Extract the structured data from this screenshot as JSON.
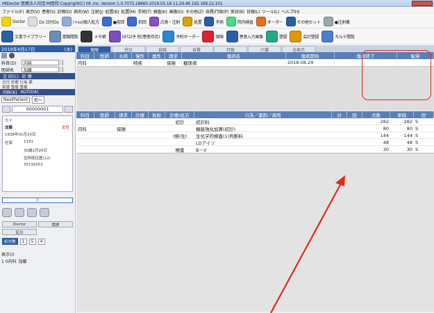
{
  "titlebar": {
    "text": "MIDoctor 医療法人社団 MI医院 Copyright(C) MI ,Inc. Version 1.0.7075.18660 2019.05.18 11:29.46 192.168.22.101"
  },
  "menu": [
    "ファイル(F)",
    "表示(V)",
    "患者(S)",
    "診療(D)",
    "病名(W)",
    "注射(J)",
    "処置(K)",
    "処置(M)",
    "手術(T)",
    "検査(K)",
    "画像(G)",
    "その他(Z)",
    "自費/行政(P)",
    "実日(B)",
    "日報(L)",
    "ツール(L)",
    "ヘルプ(H)"
  ],
  "toolbar1": [
    "Doctor",
    "Do 日付Do",
    "(+xx)個人処方",
    "●前回",
    "前回",
    "点滴・注射",
    "処置",
    "手術",
    "院内検査",
    "オーダー",
    "その他セット",
    "●注射薬"
  ],
  "toolbar2": [
    "文書ライブラリー",
    "書類閲覧",
    "メモ帳",
    "(972)予 約(患者待合)",
    "予約オーダー",
    "保険",
    "患者入力画像",
    "登録",
    "会計登録",
    "カルテ閲覧"
  ],
  "left": {
    "date": "2019年4月17日",
    "weekday": "(水)",
    "dept_label": "科目(D)",
    "dept_value": "内科",
    "doctor_label": "医師名",
    "doctor_value": "加藤",
    "shift_label": "注 記(C)",
    "record_label": "診 療",
    "options": [
      "日付",
      "診療",
      "行為",
      "薬",
      "部選",
      "重複",
      "重複",
      "重複"
    ],
    "dept2": "内科(K)",
    "autoA": "AUTO(A)",
    "next_patient": "NextPatient",
    "prev": "前へ",
    "patient_id": "00000001",
    "patient_age_label": "カナ",
    "patient_name": "加藤",
    "gender": "女性",
    "birth": "1938年01月20日",
    "insurance": "社保",
    "id2": "1191",
    "label_last": "30歳1月20日",
    "label_stat": "住所既往歴(12)",
    "label_num": "35192001",
    "btn_doc": "Doctor",
    "btn_k": "請求",
    "btn_k2": "区分",
    "rx": "処方数",
    "rx_n": [
      "1",
      "5",
      "4"
    ],
    "disp_label": "表示(I)",
    "disp_item": "1  0内科",
    "disp_doc": "加藤"
  },
  "main": {
    "tabs": [
      "保険",
      "労災",
      "自賠",
      "自費",
      "行政",
      "介護",
      "全表示"
    ],
    "disease_headers": [
      "科目",
      "医師",
      "主病",
      "慢性",
      "属性",
      "請求",
      "傷病名",
      "傷病開始",
      "傷病終了",
      "転帰"
    ],
    "disease_row": {
      "dept": "内科",
      "tokki": "特疾",
      "insurance": "保険",
      "name": "糖尿病",
      "start": "2018.08.29"
    },
    "treat_headers": [
      "科目",
      "医師",
      "請求",
      "診療",
      "負担",
      "診療/処方",
      "行為／薬剤／適用",
      "分",
      "回",
      "点数",
      "単価",
      "回"
    ],
    "treat_rows": [
      {
        "dept": "",
        "claim": "",
        "cat": "初診",
        "act": "初診料",
        "points": "282",
        "unit": "282",
        "s": "S"
      },
      {
        "dept": "内科",
        "claim": "保険",
        "cat": "",
        "act": "機能強化加算(初診)",
        "points": "80",
        "unit": "80",
        "s": "S"
      },
      {
        "dept": "",
        "claim": "",
        "cat": "(検)生Ⅰ",
        "act": "生化学的検査(1)判断料",
        "points": "144",
        "unit": "144",
        "s": "S"
      },
      {
        "dept": "",
        "claim": "",
        "cat": "",
        "act": "LDアイソ",
        "points": "48",
        "unit": "48",
        "s": "S"
      },
      {
        "dept": "",
        "claim": "",
        "cat": "検査",
        "act": "B－V",
        "points": "30",
        "unit": "30",
        "s": "S"
      }
    ]
  },
  "colors": {
    "navy": "#2a5fa8",
    "header_blue": "#5a7fb6",
    "highlight": "#e0281a"
  }
}
